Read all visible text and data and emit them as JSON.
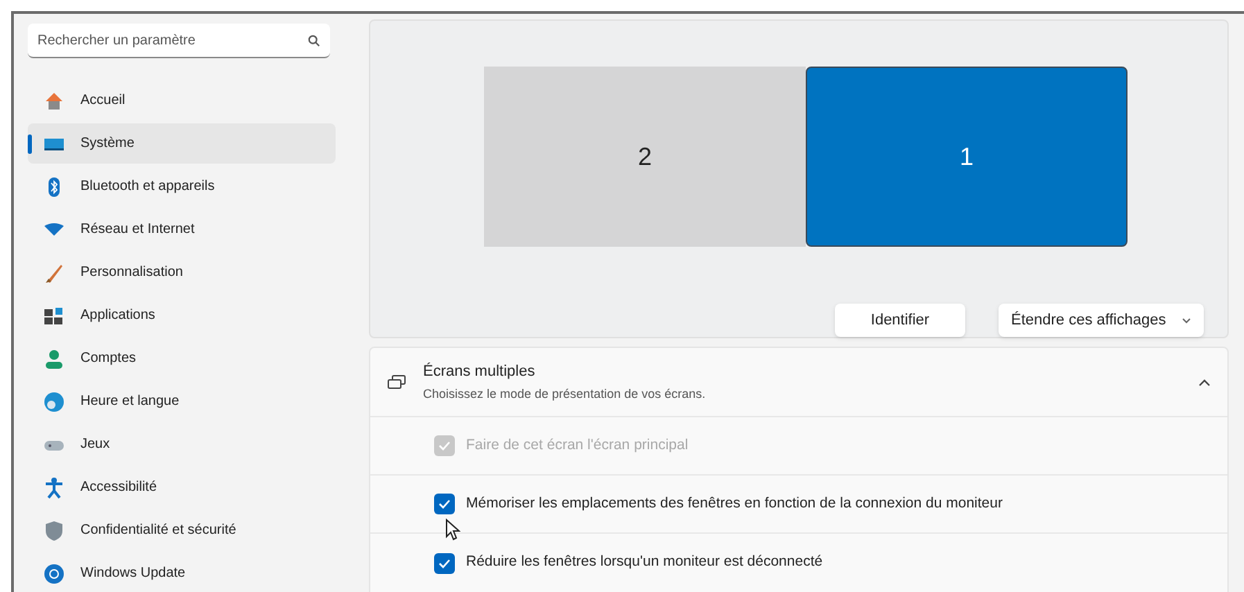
{
  "sidebar": {
    "search": {
      "placeholder": "Rechercher un paramètre"
    },
    "items": [
      {
        "label": "Accueil",
        "selected": false
      },
      {
        "label": "Système",
        "selected": true
      },
      {
        "label": "Bluetooth et appareils",
        "selected": false
      },
      {
        "label": "Réseau et Internet",
        "selected": false
      },
      {
        "label": "Personnalisation",
        "selected": false
      },
      {
        "label": "Applications",
        "selected": false
      },
      {
        "label": "Comptes",
        "selected": false
      },
      {
        "label": "Heure et langue",
        "selected": false
      },
      {
        "label": "Jeux",
        "selected": false
      },
      {
        "label": "Accessibilité",
        "selected": false
      },
      {
        "label": "Confidentialité et sécurité",
        "selected": false
      },
      {
        "label": "Windows Update",
        "selected": false
      }
    ]
  },
  "display": {
    "monitors": [
      {
        "label": "2",
        "selected": false
      },
      {
        "label": "1",
        "selected": true
      }
    ],
    "identify_button": "Identifier",
    "mode_dropdown": "Étendre ces affichages"
  },
  "multiple_displays": {
    "title": "Écrans multiples",
    "subtitle": "Choisissez le mode de présentation de vos écrans.",
    "expanded": true,
    "options": [
      {
        "label": "Faire de cet écran l'écran principal",
        "checked": true,
        "disabled": true
      },
      {
        "label": "Mémoriser les emplacements des fenêtres en fonction de la connexion du moniteur",
        "checked": true,
        "disabled": false
      },
      {
        "label": "Réduire les fenêtres lorsqu'un moniteur est déconnecté",
        "checked": true,
        "disabled": false
      }
    ]
  }
}
